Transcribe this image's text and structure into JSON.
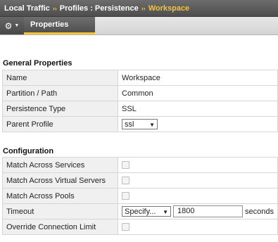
{
  "breadcrumb": {
    "part1": "Local Traffic",
    "part2": "Profiles : Persistence",
    "current": "Workspace",
    "separator": "››"
  },
  "tabs": {
    "gear_icon": "gear-icon",
    "properties_label": "Properties"
  },
  "general": {
    "header": "General Properties",
    "rows": {
      "name": {
        "label": "Name",
        "value": "Workspace"
      },
      "partition": {
        "label": "Partition / Path",
        "value": "Common"
      },
      "persistence_type": {
        "label": "Persistence Type",
        "value": "SSL"
      },
      "parent_profile": {
        "label": "Parent Profile",
        "value": "ssl"
      }
    }
  },
  "configuration": {
    "header": "Configuration",
    "rows": {
      "match_services": {
        "label": "Match Across Services",
        "checked": false
      },
      "match_virtual_servers": {
        "label": "Match Across Virtual Servers",
        "checked": false
      },
      "match_pools": {
        "label": "Match Across Pools",
        "checked": false
      },
      "timeout": {
        "label": "Timeout",
        "mode": "Specify...",
        "value": "1800",
        "unit": "seconds"
      },
      "override_limit": {
        "label": "Override Connection Limit",
        "checked": false
      }
    }
  },
  "colors": {
    "accent": "#f3c43a",
    "bar_dark": "#505050",
    "label_bg": "#f0f0f0"
  }
}
